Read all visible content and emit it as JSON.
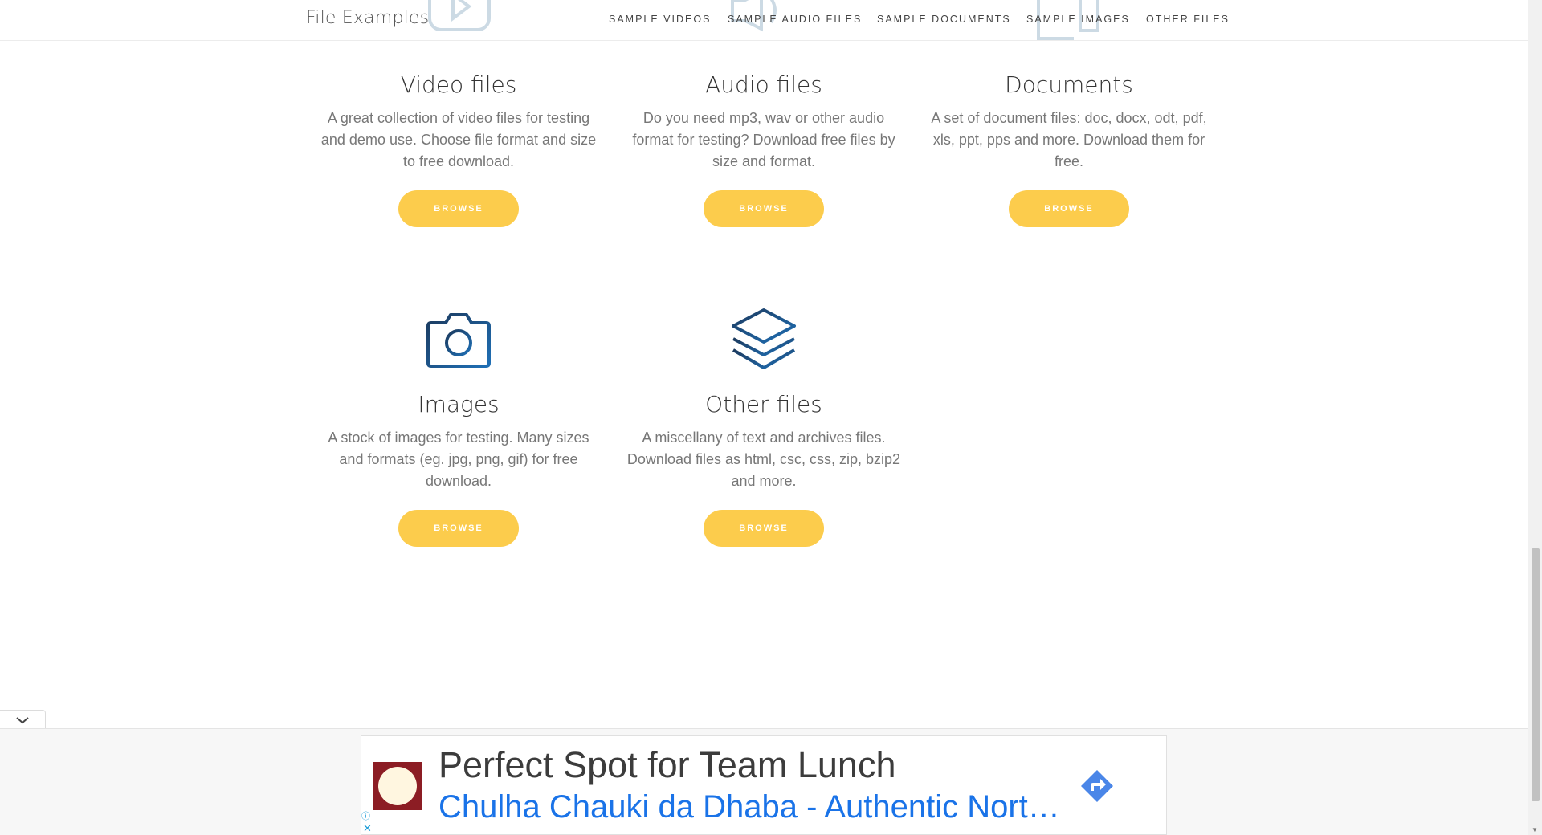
{
  "header": {
    "site_title": "File Examples",
    "nav": [
      {
        "label": "SAMPLE VIDEOS"
      },
      {
        "label": "SAMPLE AUDIO FILES"
      },
      {
        "label": "SAMPLE DOCUMENTS"
      },
      {
        "label": "SAMPLE IMAGES"
      },
      {
        "label": "OTHER FILES"
      }
    ]
  },
  "cards": [
    {
      "title": "Video files",
      "description": "A great collection of video files for testing and demo use. Choose file format and size to free download.",
      "button": "BROWSE"
    },
    {
      "title": "Audio files",
      "description": "Do you need mp3, wav or other audio format for testing? Download free files by size and format.",
      "button": "BROWSE"
    },
    {
      "title": "Documents",
      "description": "A set of document files: doc, docx, odt, pdf, xls, ppt, pps and more. Download them for free.",
      "button": "BROWSE"
    },
    {
      "title": "Images",
      "description": "A stock of images for testing. Many sizes and formats (eg. jpg, png, gif) for free download.",
      "button": "BROWSE"
    },
    {
      "title": "Other files",
      "description": "A miscellany of text and archives files. Download files as html, csc, css, zip, bzip2 and more.",
      "button": "BROWSE"
    }
  ],
  "ad": {
    "headline": "Perfect Spot for Team Lunch",
    "subline": "Chulha Chauki da Dhaba - Authentic North Indian Food",
    "info_glyph": "ⓘ",
    "close_glyph": "✕"
  },
  "colors": {
    "button": "#fccc4c",
    "icon_dark": "#1c3a5e",
    "icon_blue": "#1f6fb5",
    "ad_link": "#1a73e8"
  },
  "icons": {
    "camera": "camera-icon",
    "layers": "layers-icon",
    "collapse": "chevron-down-icon",
    "directions": "directions-icon"
  }
}
